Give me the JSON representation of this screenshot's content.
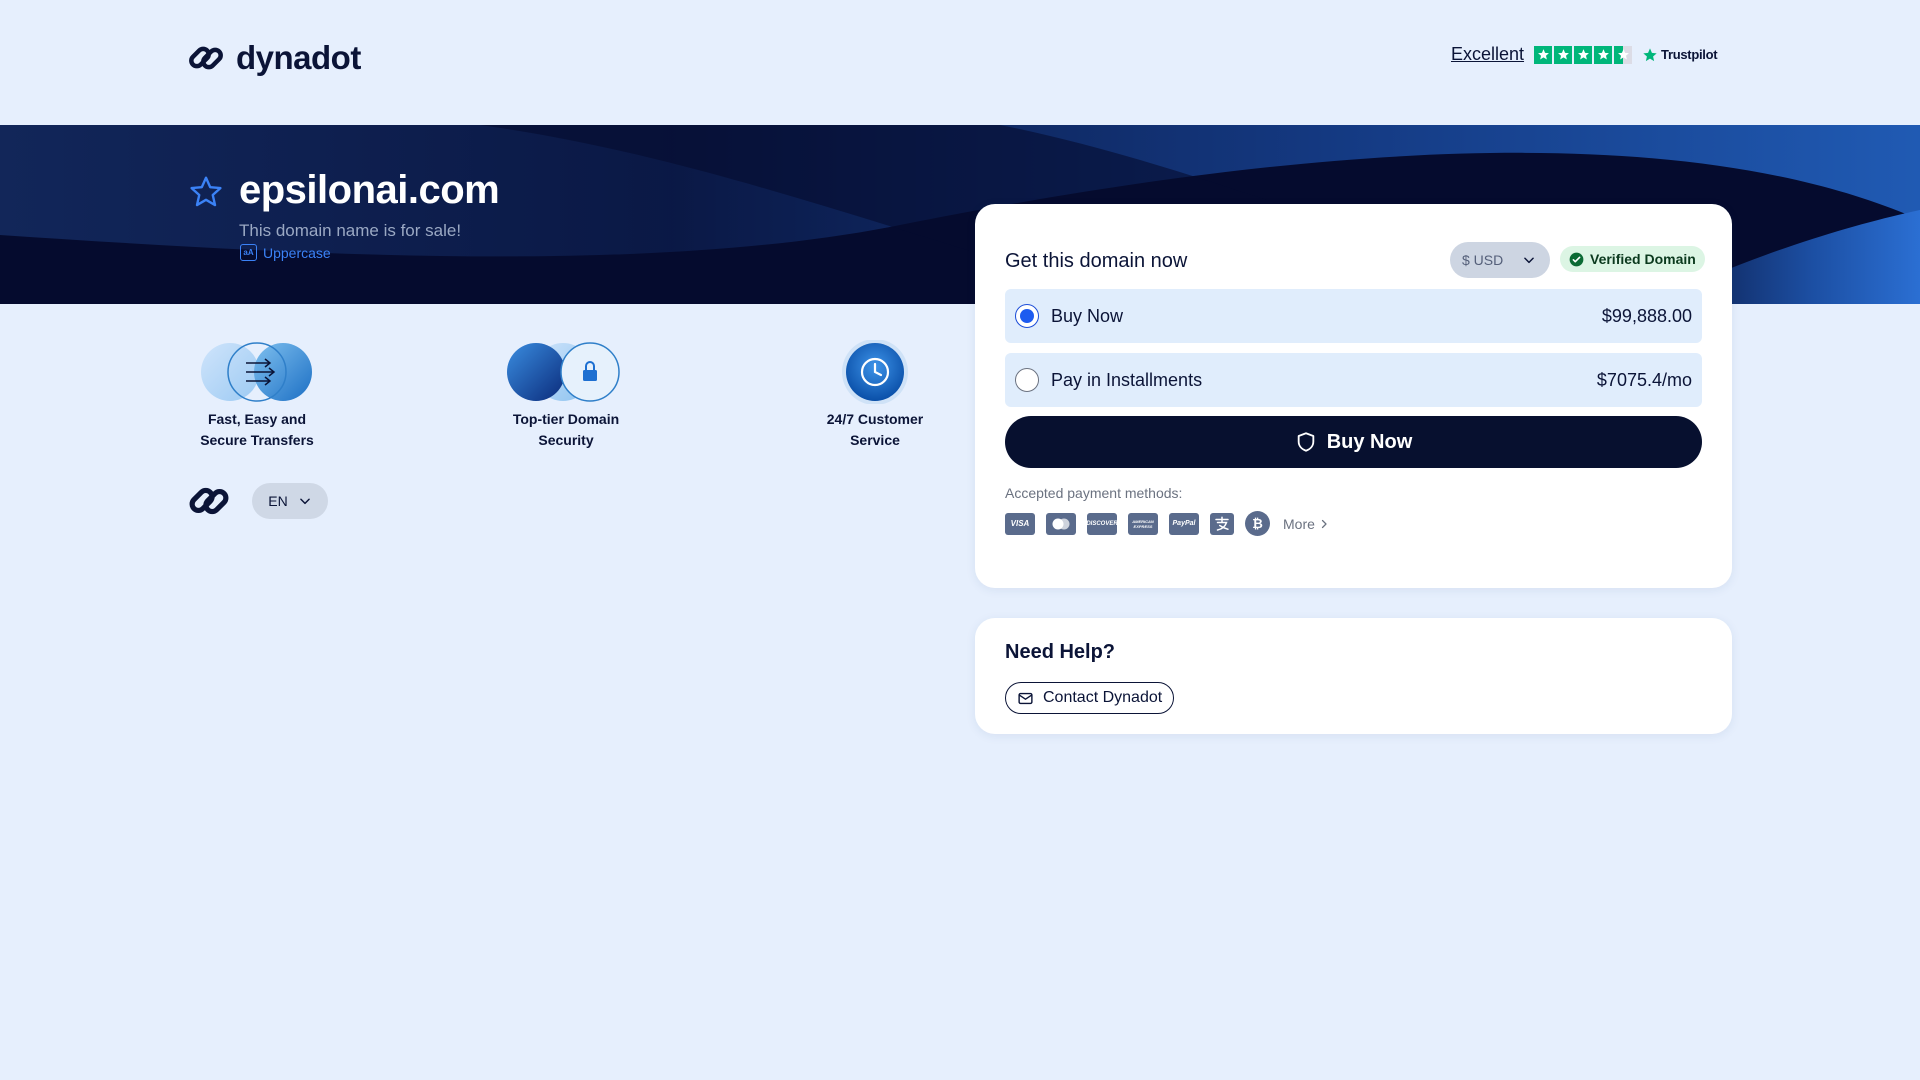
{
  "header": {
    "brand": "dynadot",
    "rating_label": "Excellent",
    "trust_brand": "Trustpilot",
    "trust_score_stars": 4.5
  },
  "hero": {
    "domain": "epsilonai.com",
    "subtitle": "This domain name is for sale!",
    "uppercase_label": "Uppercase",
    "uppercase_icon_text": "aA"
  },
  "features": [
    {
      "line1": "Fast, Easy and",
      "line2": "Secure Transfers"
    },
    {
      "line1": "Top-tier Domain",
      "line2": "Security"
    },
    {
      "line1": "24/7 Customer",
      "line2": "Service"
    }
  ],
  "language": {
    "selected": "EN"
  },
  "purchase": {
    "title": "Get this domain now",
    "currency": "$ USD",
    "verified_label": "Verified Domain",
    "options": [
      {
        "label": "Buy Now",
        "price": "$99,888.00",
        "selected": true
      },
      {
        "label": "Pay in Installments",
        "price": "$7075.4/mo",
        "selected": false
      }
    ],
    "buy_button": "Buy Now",
    "payment_label": "Accepted payment methods:",
    "payment_methods": {
      "visa": "VISA",
      "mastercard": "mastercard",
      "discover": "DISCOVER",
      "amex": "AMERICAN EXPRESS",
      "paypal": "PayPal",
      "alipay": "alipay",
      "bitcoin": "₿"
    },
    "more_label": "More"
  },
  "help": {
    "title": "Need Help?",
    "contact_label": "Contact Dynadot"
  },
  "colors": {
    "page_bg": "#e6effd",
    "hero_bg": "#050b2e",
    "accent_blue": "#1d5bf0",
    "trust_green": "#00b67a",
    "button_dark": "#07102f",
    "option_bg": "#e0edfc"
  }
}
